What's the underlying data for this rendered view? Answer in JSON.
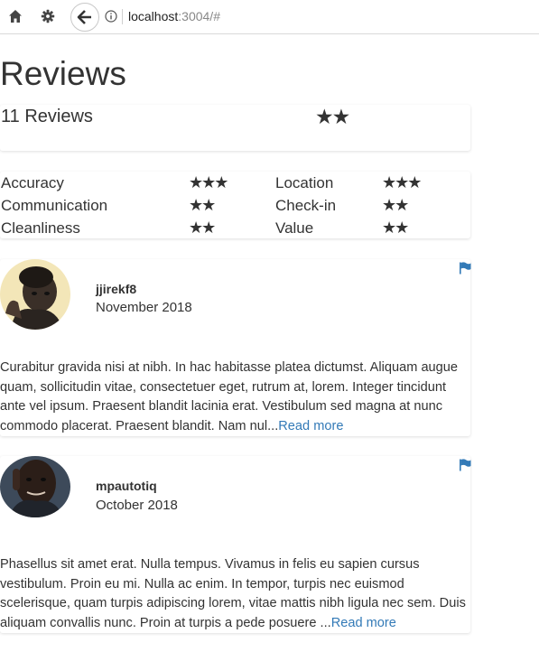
{
  "browser": {
    "url_host": "localhost",
    "url_rest": ":3004/#",
    "icons": [
      "home-icon",
      "gear-icon",
      "back-arrow-icon",
      "info-icon"
    ]
  },
  "page": {
    "title": "Reviews"
  },
  "summary": {
    "count_label": "11 Reviews",
    "stars": "★★",
    "star_rating": 2
  },
  "ratings": [
    {
      "label": "Accuracy",
      "stars": "★★★",
      "value": 3
    },
    {
      "label": "Location",
      "stars": "★★★",
      "value": 3
    },
    {
      "label": "Communication",
      "stars": "★★",
      "value": 2
    },
    {
      "label": "Check-in",
      "stars": "★★",
      "value": 2
    },
    {
      "label": "Cleanliness",
      "stars": "★★",
      "value": 2
    },
    {
      "label": "Value",
      "stars": "★★",
      "value": 2
    }
  ],
  "reviews": [
    {
      "username": "jjirekf8",
      "date": "November 2018",
      "text": "Curabitur gravida nisi at nibh. In hac habitasse platea dictumst. Aliquam augue quam, sollicitudin vitae, consectetuer eget, rutrum at, lorem. Integer tincidunt ante vel ipsum. Praesent blandit lacinia erat. Vestibulum sed magna at nunc commodo placerat. Praesent blandit. Nam nul...",
      "read_more": "Read more"
    },
    {
      "username": "mpautotiq",
      "date": "October 2018",
      "text": "Phasellus sit amet erat. Nulla tempus. Vivamus in felis eu sapien cursus vestibulum. Proin eu mi. Nulla ac enim. In tempor, turpis nec euismod scelerisque, quam turpis adipiscing lorem, vitae mattis nibh ligula nec sem. Duis aliquam convallis nunc. Proin at turpis a pede posuere ...",
      "read_more": "Read more"
    }
  ],
  "colors": {
    "text": "#333333",
    "link": "#337ab7",
    "flag": "#337ab7"
  }
}
